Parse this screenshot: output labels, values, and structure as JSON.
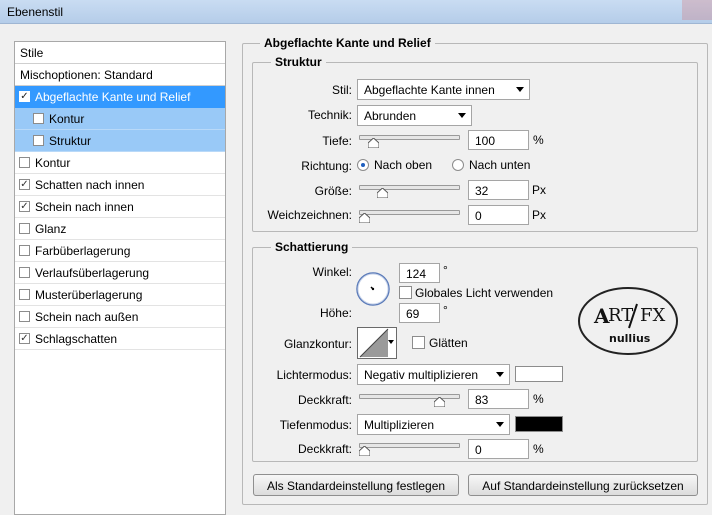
{
  "window": {
    "title": "Ebenenstil"
  },
  "colors": {
    "selected_bg": "#3399ff",
    "sub_bg": "#99c9f7",
    "shadow_color": "#000000",
    "light_color": "#ffffff"
  },
  "styles_list": {
    "header": "Stile",
    "blend_options": "Mischoptionen: Standard",
    "items": [
      {
        "label": "Abgeflachte Kante und Relief",
        "checked": true,
        "selected": true
      },
      {
        "label": "Kontur",
        "checked": false,
        "sub": true
      },
      {
        "label": "Struktur",
        "checked": false,
        "sub": true
      },
      {
        "label": "Kontur",
        "checked": false
      },
      {
        "label": "Schatten nach innen",
        "checked": true
      },
      {
        "label": "Schein nach innen",
        "checked": true
      },
      {
        "label": "Glanz",
        "checked": false
      },
      {
        "label": "Farbüberlagerung",
        "checked": false
      },
      {
        "label": "Verlaufsüberlagerung",
        "checked": false
      },
      {
        "label": "Musterüberlagerung",
        "checked": false
      },
      {
        "label": "Schein nach außen",
        "checked": false
      },
      {
        "label": "Schlagschatten",
        "checked": true
      }
    ]
  },
  "panel": {
    "title": "Abgeflachte Kante und Relief",
    "structure": {
      "title": "Struktur",
      "style_label": "Stil:",
      "style_value": "Abgeflachte Kante innen",
      "technique_label": "Technik:",
      "technique_value": "Abrunden",
      "depth_label": "Tiefe:",
      "depth_value": "100",
      "depth_unit": "%",
      "depth_fraction": 0.1,
      "direction_label": "Richtung:",
      "direction_up": "Nach oben",
      "direction_down": "Nach unten",
      "size_label": "Größe:",
      "size_value": "32",
      "size_unit": "Px",
      "size_fraction": 0.2,
      "soften_label": "Weichzeichnen:",
      "soften_value": "0",
      "soften_unit": "Px",
      "soften_fraction": 0.0
    },
    "shading": {
      "title": "Schattierung",
      "angle_label": "Winkel:",
      "angle_value": "124",
      "angle_unit": "°",
      "global_light_label": "Globales Licht verwenden",
      "altitude_label": "Höhe:",
      "altitude_value": "69",
      "altitude_unit": "°",
      "gloss_label": "Glanzkontur:",
      "antialias_label": "Glätten",
      "highlight_mode_label": "Lichtermodus:",
      "highlight_mode_value": "Negativ multiplizieren",
      "highlight_opacity_label": "Deckkraft:",
      "highlight_opacity_value": "83",
      "highlight_opacity_unit": "%",
      "highlight_opacity_fraction": 0.83,
      "shadow_mode_label": "Tiefenmodus:",
      "shadow_mode_value": "Multiplizieren",
      "shadow_opacity_label": "Deckkraft:",
      "shadow_opacity_value": "0",
      "shadow_opacity_unit": "%",
      "shadow_opacity_fraction": 0.0
    },
    "buttons": {
      "make_default": "Als Standardeinstellung festlegen",
      "reset_default": "Auf Standardeinstellung zurücksetzen"
    }
  },
  "logo": {
    "text_top": "ART/FX",
    "text_bottom": "nullius"
  }
}
